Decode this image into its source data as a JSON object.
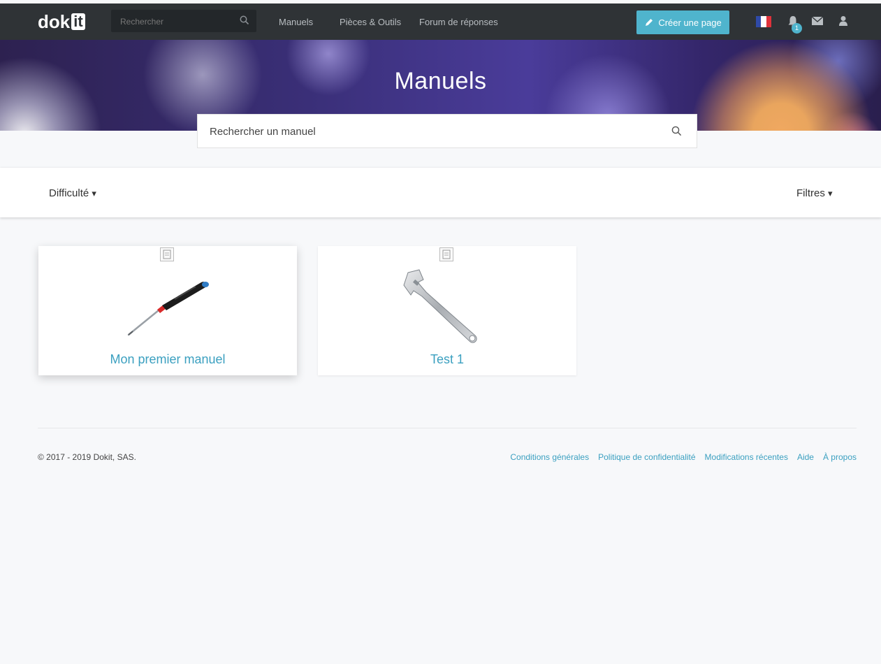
{
  "brand": {
    "logo_text": "dok",
    "logo_box": "it"
  },
  "topbar": {
    "search_placeholder": "Rechercher",
    "nav": [
      "Manuels",
      "Pièces & Outils",
      "Forum de réponses"
    ],
    "create_button": "Créer une page",
    "notification_count": "1",
    "accent_color": "#4fb4cd"
  },
  "hero": {
    "title": "Manuels",
    "search_placeholder": "Rechercher un manuel"
  },
  "filters": {
    "left": "Difficulté",
    "right": "Filtres"
  },
  "cards": [
    {
      "title": "Mon premier manuel",
      "image": "screwdriver"
    },
    {
      "title": "Test 1",
      "image": "adjustable-wrench"
    }
  ],
  "footer": {
    "copyright": "© 2017 - 2019 Dokit, SAS.",
    "links": [
      "Conditions générales",
      "Politique de confidentialité",
      "Modifications récentes",
      "Aide",
      "À propos"
    ]
  }
}
